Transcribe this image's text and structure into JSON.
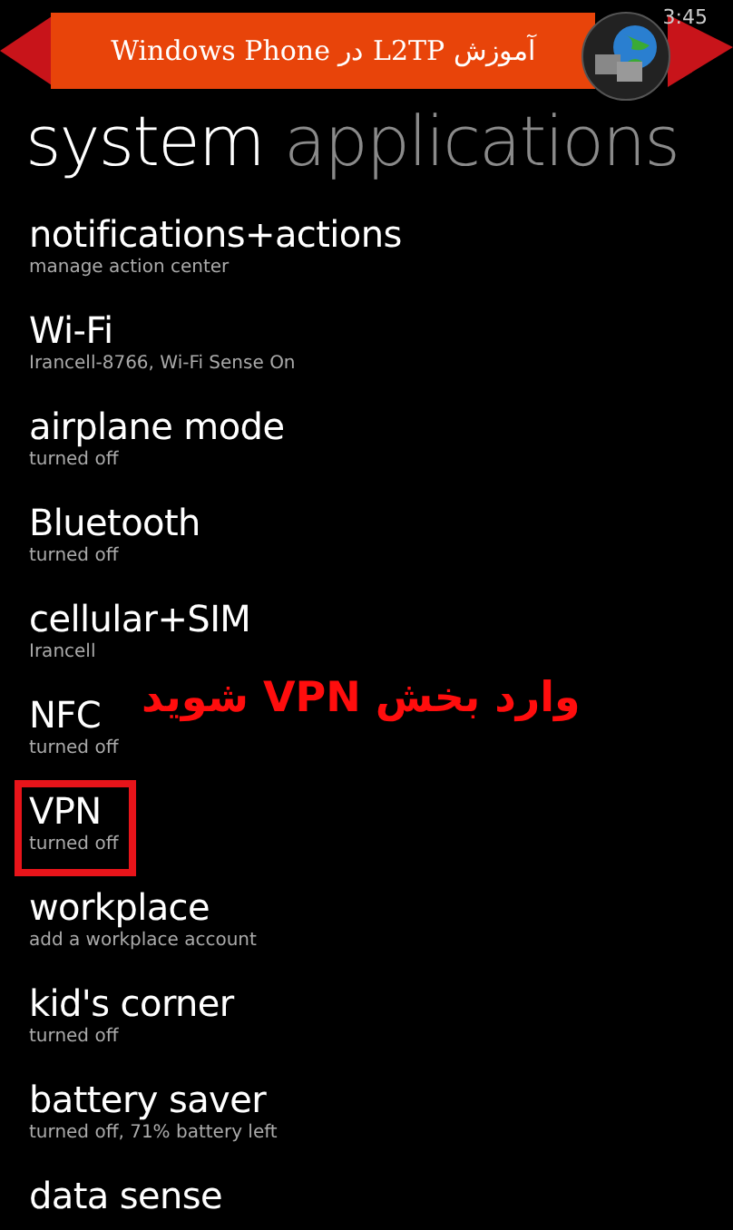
{
  "banner": {
    "title": "آموزش L2TP در Windows Phone"
  },
  "status_bar": {
    "time": "3:45"
  },
  "pivot": [
    {
      "label": "system",
      "selected": true
    },
    {
      "label": "applications",
      "selected": false
    }
  ],
  "settings": [
    {
      "title": "notifications+actions",
      "subtitle": "manage action center",
      "highlighted": false
    },
    {
      "title": "Wi-Fi",
      "subtitle": "Irancell-8766, Wi-Fi Sense On",
      "highlighted": false
    },
    {
      "title": "airplane mode",
      "subtitle": "turned off",
      "highlighted": false
    },
    {
      "title": "Bluetooth",
      "subtitle": "turned off",
      "highlighted": false
    },
    {
      "title": "cellular+SIM",
      "subtitle": "Irancell",
      "highlighted": false
    },
    {
      "title": "NFC",
      "subtitle": "turned off",
      "highlighted": false
    },
    {
      "title": "VPN",
      "subtitle": "turned off",
      "highlighted": true
    },
    {
      "title": "workplace",
      "subtitle": "add a workplace account",
      "highlighted": false
    },
    {
      "title": "kid's corner",
      "subtitle": "turned off",
      "highlighted": false
    },
    {
      "title": "battery saver",
      "subtitle": "turned off, 71% battery left",
      "highlighted": false
    },
    {
      "title": "data sense"
    }
  ],
  "annotation": "وارد بخش VPN شوید"
}
